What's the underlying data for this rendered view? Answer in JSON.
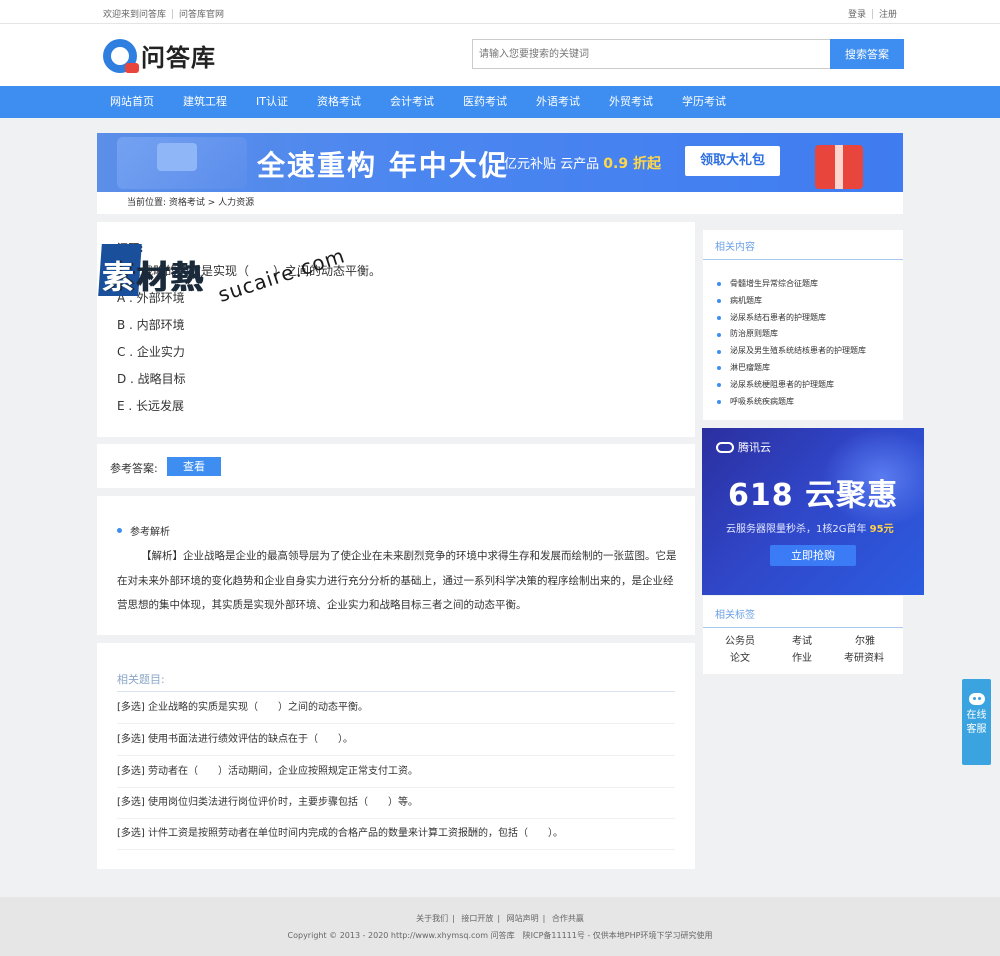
{
  "topbar": {
    "welcome": "欢迎来到问答库",
    "official": "问答库官网",
    "login": "登录",
    "register": "注册"
  },
  "header": {
    "logo_text": "问答库",
    "search_placeholder": "请输入您要搜索的关键词",
    "search_button": "搜索答案"
  },
  "nav": [
    "网站首页",
    "建筑工程",
    "IT认证",
    "资格考试",
    "会计考试",
    "医药考试",
    "外语考试",
    "外贸考试",
    "学历考试"
  ],
  "banner": {
    "title": "全速重构 年中大促",
    "sub_prefix": "亿元补贴 云产品 ",
    "sub_highlight": "0.9 折起",
    "button": "领取大礼包"
  },
  "breadcrumb": {
    "prefix": "当前位置:",
    "path": "资格考试 > 人力资源"
  },
  "question": {
    "label": "问题:",
    "text": "企业战略的实质是实现（　　）之间的动态平衡。",
    "options": [
      "A . 外部环境",
      "B . 内部环境",
      "C . 企业实力",
      "D . 战略目标",
      "E . 长远发展"
    ],
    "watermark_cn_1": "素",
    "watermark_cn_2": "材熱",
    "watermark_en": "sucaire.com"
  },
  "answer": {
    "label": "参考答案:",
    "button": "查看"
  },
  "explanation": {
    "heading": "参考解析",
    "body": "【解析】企业战略是企业的最高领导层为了使企业在未来剧烈竞争的环境中求得生存和发展而绘制的一张蓝图。它是在对未来外部环境的变化趋势和企业自身实力进行充分分析的基础上，通过一系列科学决策的程序绘制出来的，是企业经营思想的集中体现，其实质是实现外部环境、企业实力和战略目标三者之间的动态平衡。"
  },
  "related_questions": {
    "heading": "相关题目:",
    "items": [
      "[多选] 企业战略的实质是实现（　　）之间的动态平衡。",
      "[多选] 使用书面法进行绩效评估的缺点在于（　　）。",
      "[多选] 劳动者在（　　）活动期间，企业应按照规定正常支付工资。",
      "[多选] 使用岗位归类法进行岗位评价时，主要步骤包括（　　）等。",
      "[多选] 计件工资是按照劳动者在单位时间内完成的合格产品的数量来计算工资报酬的，包括（　　）。"
    ]
  },
  "sidebar": {
    "related_heading": "相关内容",
    "related_items": [
      "骨髓增生异常综合征题库",
      "病机题库",
      "泌尿系结石患者的护理题库",
      "防治原则题库",
      "泌尿及男生殖系统结核患者的护理题库",
      "淋巴瘤题库",
      "泌尿系统梗阻患者的护理题库",
      "呼吸系统疾病题库"
    ],
    "tags_heading": "相关标签",
    "tags": [
      "公务员",
      "考试",
      "尔雅",
      "论文",
      "作业",
      "考研资料"
    ]
  },
  "ad": {
    "brand": "腾讯云",
    "title": "618 云聚惠",
    "sub_prefix": "云服务器限量秒杀，1核2G首年 ",
    "sub_price": "95元",
    "button": "立即抢购"
  },
  "footer": {
    "links": [
      "关于我们",
      "接口开放",
      "网站声明",
      "合作共赢"
    ],
    "copyright": "Copyright © 2013 - 2020 http://www.xhymsq.com  问答库　陕ICP备11111号 - 仅供本地PHP环境下学习研究使用"
  },
  "kefu": {
    "label": "在线客服"
  }
}
